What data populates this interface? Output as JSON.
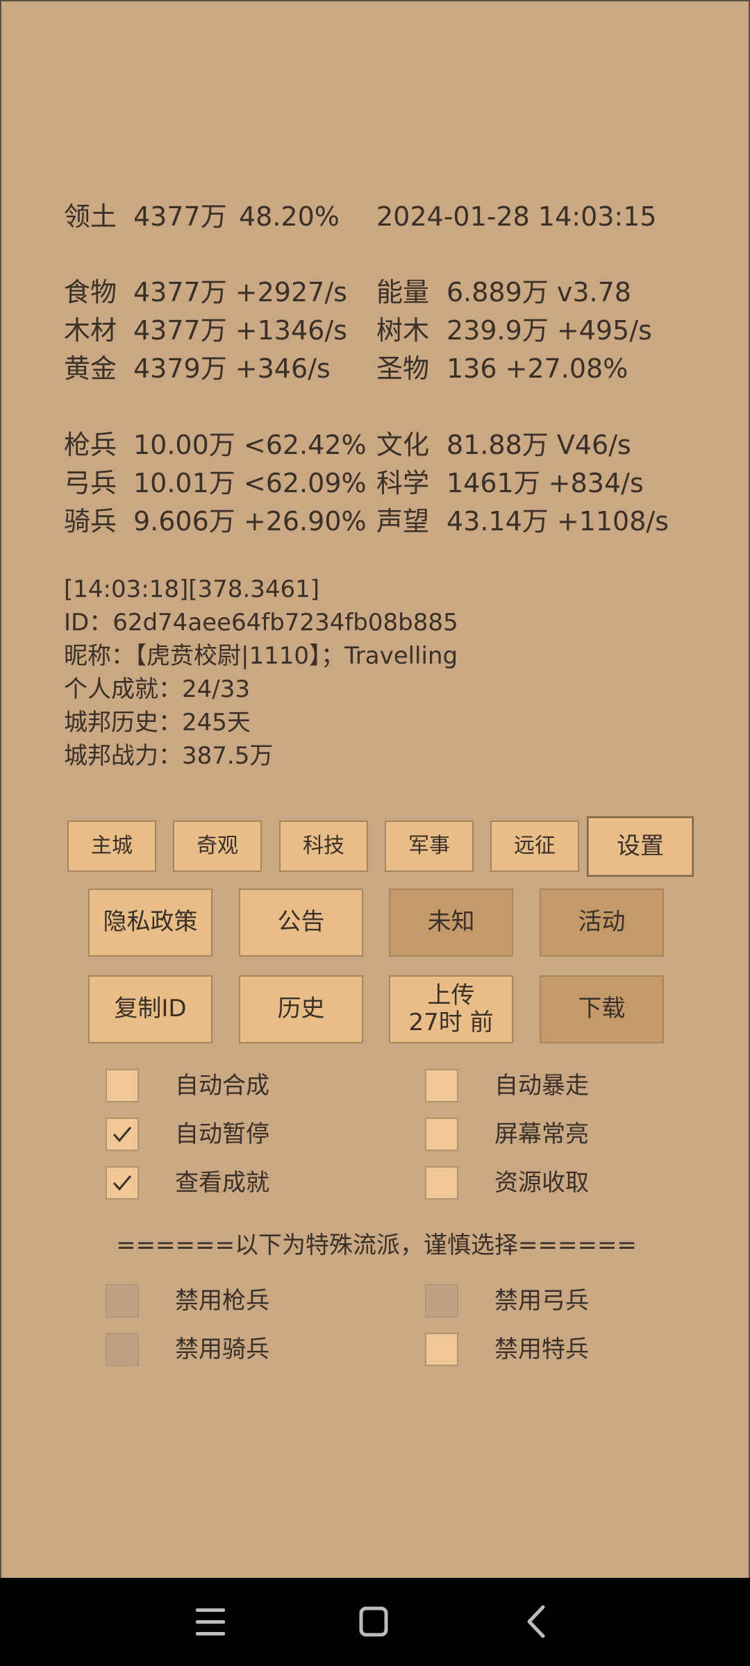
{
  "header": {
    "territory_label": "领土",
    "territory_value": "4377万",
    "territory_percent": "48.20%",
    "datetime": "2024-01-28 14:03:15"
  },
  "resources": [
    {
      "label": "食物",
      "value": "4377万 +2927/s"
    },
    {
      "label": "能量",
      "value": "6.889万  v3.78"
    },
    {
      "label": "木材",
      "value": "4377万 +1346/s"
    },
    {
      "label": "树木",
      "value": "239.9万 +495/s"
    },
    {
      "label": "黄金",
      "value": "4379万 +346/s"
    },
    {
      "label": "圣物",
      "value": "136 +27.08%"
    }
  ],
  "army": [
    {
      "label": "枪兵",
      "value": "10.00万 <62.42%"
    },
    {
      "label": "文化",
      "value": "81.88万 V46/s"
    },
    {
      "label": "弓兵",
      "value": "10.01万 <62.09%"
    },
    {
      "label": "科学",
      "value": "1461万 +834/s"
    },
    {
      "label": "骑兵",
      "value": "9.606万 +26.90%"
    },
    {
      "label": "声望",
      "value": "43.14万 +1108/s"
    }
  ],
  "info": {
    "time_line": "[14:03:18][378.3461]",
    "id_line": "ID：62d74aee64fb7234fb08b885",
    "nickname_line": "昵称：【虎贲校尉|1110】；Travelling",
    "achievement_line": "个人成就：24/33",
    "history_line": "城邦历史：245天",
    "power_line": "城邦战力：387.5万"
  },
  "tabs": [
    "主城",
    "奇观",
    "科技",
    "军事",
    "远征",
    "设置"
  ],
  "active_tab": "设置",
  "buttons_row1": [
    "隐私政策",
    "公告",
    "未知",
    "活动"
  ],
  "buttons_row2": {
    "copy_id": "复制ID",
    "history": "历史",
    "upload_line1": "上传",
    "upload_line2": "27时 前",
    "download": "下载"
  },
  "options": {
    "auto_craft": {
      "label": "自动合成",
      "checked": false
    },
    "auto_rampage": {
      "label": "自动暴走",
      "checked": false
    },
    "auto_pause": {
      "label": "自动暂停",
      "checked": true
    },
    "screen_on": {
      "label": "屏幕常亮",
      "checked": false
    },
    "view_achievements": {
      "label": "查看成就",
      "checked": true
    },
    "resource_collect": {
      "label": "资源收取",
      "checked": false
    }
  },
  "divider_text": "======以下为特殊流派，谨慎选择======",
  "special": {
    "disable_spear": {
      "label": "禁用枪兵",
      "enabled": false
    },
    "disable_archer": {
      "label": "禁用弓兵",
      "enabled": false
    },
    "disable_cavalry": {
      "label": "禁用骑兵",
      "enabled": false
    },
    "disable_special": {
      "label": "禁用特兵",
      "enabled": true
    }
  },
  "navbar_icons": [
    "menu-icon",
    "home-square-icon",
    "back-chevron-icon"
  ]
}
